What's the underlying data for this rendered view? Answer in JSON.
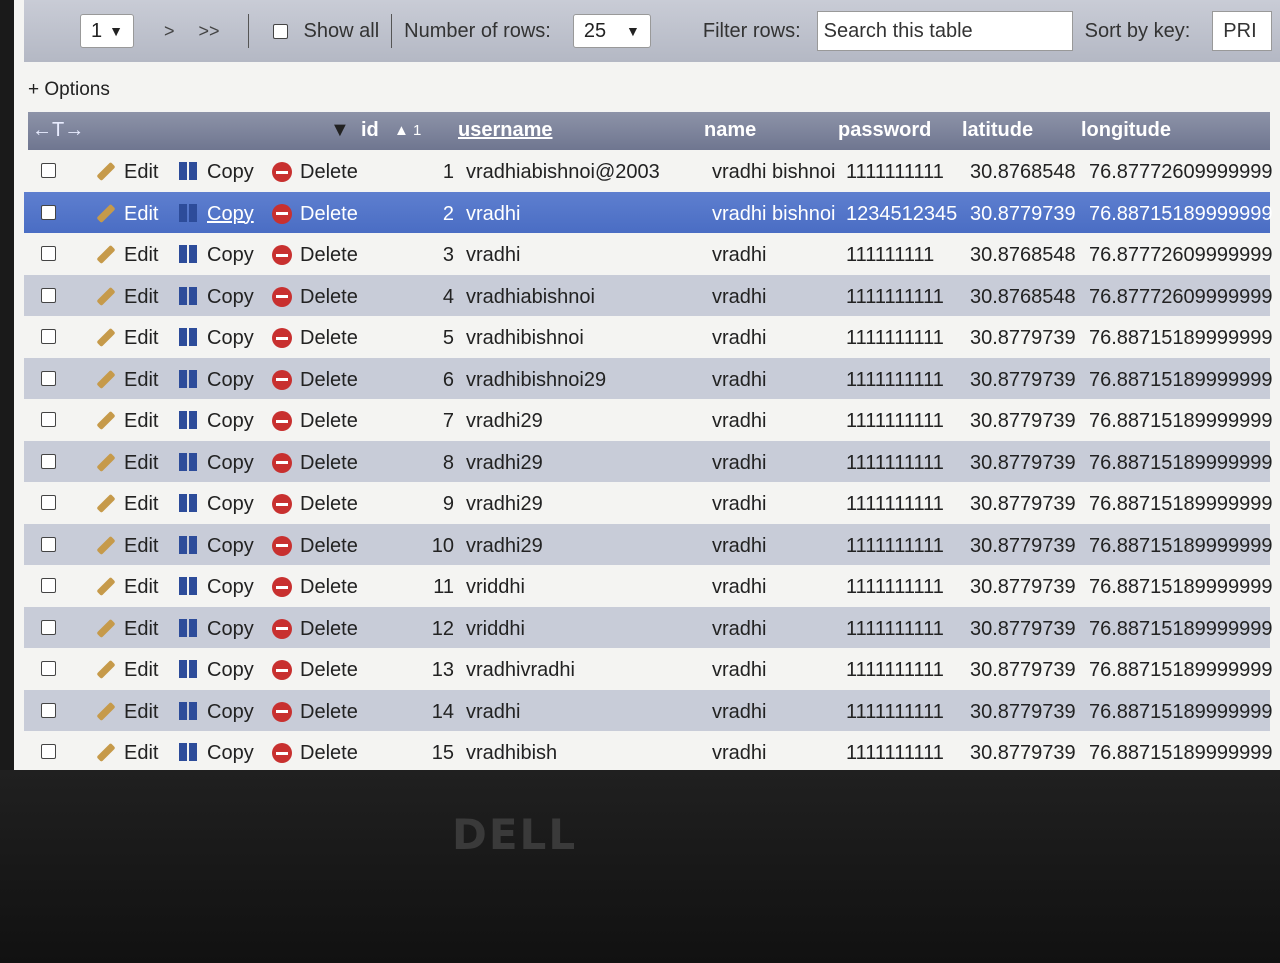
{
  "toolbar": {
    "page_select": "1",
    "next_label": ">",
    "last_label": ">>",
    "show_all_label": "Show all",
    "rows_label": "Number of rows:",
    "rows_value": "25",
    "filter_label": "Filter rows:",
    "search_placeholder": "Search this table",
    "sort_label": "Sort by key:",
    "sort_value": "PRI"
  },
  "options_label": "+ Options",
  "actions": {
    "edit": "Edit",
    "copy": "Copy",
    "delete": "Delete"
  },
  "columns": {
    "arrows": "←T→",
    "id": "id",
    "sort_indicator": "▲ 1",
    "username": "username",
    "name": "name",
    "password": "password",
    "latitude": "latitude",
    "longitude": "longitude"
  },
  "rows": [
    {
      "id": "1",
      "username": "vradhiabishnoi@2003",
      "name": "vradhi bishnoi",
      "password": "1111111111",
      "latitude": "30.8768548",
      "longitude": "76.87772609999999"
    },
    {
      "id": "2",
      "username": "vradhi",
      "name": "vradhi bishnoi",
      "password": "1234512345",
      "latitude": "30.8779739",
      "longitude": "76.88715189999999"
    },
    {
      "id": "3",
      "username": "vradhi",
      "name": "vradhi",
      "password": "111111111",
      "latitude": "30.8768548",
      "longitude": "76.87772609999999"
    },
    {
      "id": "4",
      "username": "vradhiabishnoi",
      "name": "vradhi",
      "password": "1111111111",
      "latitude": "30.8768548",
      "longitude": "76.87772609999999"
    },
    {
      "id": "5",
      "username": "vradhibishnoi",
      "name": "vradhi",
      "password": "1111111111",
      "latitude": "30.8779739",
      "longitude": "76.88715189999999"
    },
    {
      "id": "6",
      "username": "vradhibishnoi29",
      "name": "vradhi",
      "password": "1111111111",
      "latitude": "30.8779739",
      "longitude": "76.88715189999999"
    },
    {
      "id": "7",
      "username": "vradhi29",
      "name": "vradhi",
      "password": "1111111111",
      "latitude": "30.8779739",
      "longitude": "76.88715189999999"
    },
    {
      "id": "8",
      "username": "vradhi29",
      "name": "vradhi",
      "password": "1111111111",
      "latitude": "30.8779739",
      "longitude": "76.88715189999999"
    },
    {
      "id": "9",
      "username": "vradhi29",
      "name": "vradhi",
      "password": "1111111111",
      "latitude": "30.8779739",
      "longitude": "76.88715189999999"
    },
    {
      "id": "10",
      "username": "vradhi29",
      "name": "vradhi",
      "password": "1111111111",
      "latitude": "30.8779739",
      "longitude": "76.88715189999999"
    },
    {
      "id": "11",
      "username": "vriddhi",
      "name": "vradhi",
      "password": "1111111111",
      "latitude": "30.8779739",
      "longitude": "76.88715189999999"
    },
    {
      "id": "12",
      "username": "vriddhi",
      "name": "vradhi",
      "password": "1111111111",
      "latitude": "30.8779739",
      "longitude": "76.88715189999999"
    },
    {
      "id": "13",
      "username": "vradhivradhi",
      "name": "vradhi",
      "password": "1111111111",
      "latitude": "30.8779739",
      "longitude": "76.88715189999999"
    },
    {
      "id": "14",
      "username": "vradhi",
      "name": "vradhi",
      "password": "1111111111",
      "latitude": "30.8779739",
      "longitude": "76.88715189999999"
    },
    {
      "id": "15",
      "username": "vradhibish",
      "name": "vradhi",
      "password": "1111111111",
      "latitude": "30.8779739",
      "longitude": "76.88715189999999"
    }
  ],
  "selected_row": 2,
  "bezel_logo": "DELL",
  "colors": {
    "header": "#7a8199",
    "row_alt": "#c8ccd8",
    "row_selected": "#5577c9",
    "delete": "#c8302f"
  }
}
